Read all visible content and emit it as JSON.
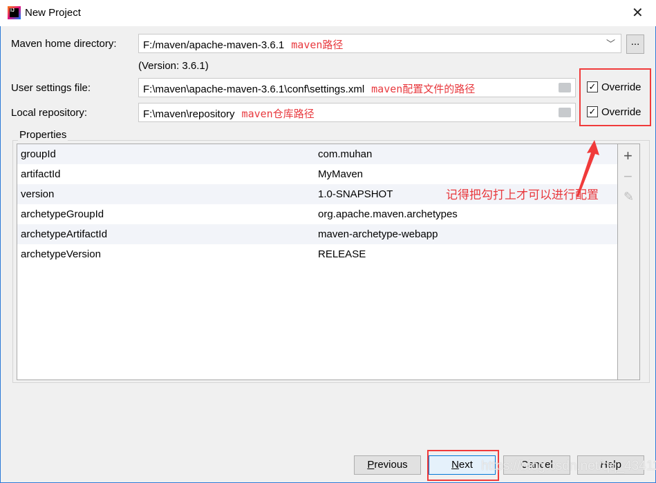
{
  "window": {
    "title": "New Project"
  },
  "form": {
    "maven_home_label": "Maven home directory:",
    "maven_home_value": "F:/maven/apache-maven-3.6.1",
    "maven_home_note": "maven路径",
    "version": "(Version: 3.6.1)",
    "browse_label": "...",
    "user_settings_label": "User settings file:",
    "user_settings_value": "F:\\maven\\apache-maven-3.6.1\\conf\\settings.xml",
    "user_settings_note": "maven配置文件的路径",
    "local_repo_label": "Local repository:",
    "local_repo_value": "F:\\maven\\repository",
    "local_repo_note": "maven仓库路径",
    "override_label": "Override",
    "override_settings_checked": true,
    "override_repo_checked": true
  },
  "properties": {
    "title": "Properties",
    "rows": [
      {
        "key": "groupId",
        "value": "com.muhan"
      },
      {
        "key": "artifactId",
        "value": "MyMaven"
      },
      {
        "key": "version",
        "value": "1.0-SNAPSHOT"
      },
      {
        "key": "archetypeGroupId",
        "value": "org.apache.maven.archetypes"
      },
      {
        "key": "archetypeArtifactId",
        "value": "maven-archetype-webapp"
      },
      {
        "key": "archetypeVersion",
        "value": "RELEASE"
      }
    ]
  },
  "annotation": {
    "text": "记得把勾打上才可以进行配置",
    "color": "#e8383d"
  },
  "buttons": {
    "previous_u": "P",
    "previous_rest": "revious",
    "next_u": "N",
    "next_rest": "ext",
    "cancel": "Cancel",
    "help": "Help"
  },
  "watermark": "https://blog.csdn.net/qq_43411550"
}
